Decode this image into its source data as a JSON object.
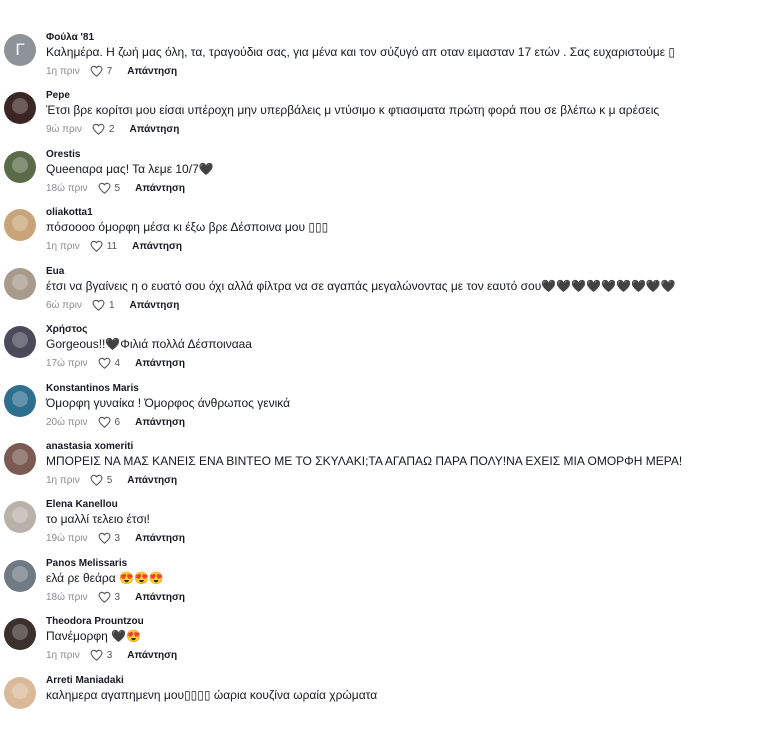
{
  "comments": [
    {
      "username": "Φούλα '81",
      "text": "Καλημέρα. Η ζωή μας όλη, τα, τραγούδια σας, για μένα και τον σύζυγό απ οταν ειμασταν 17 ετών . Σας ευχαριστούμε ▯",
      "time": "1η πριν",
      "likes": "7",
      "reply": "Απάντηση",
      "avatar_letter": "Γ",
      "avatar_color": "#8e939a"
    },
    {
      "username": "Pepe",
      "text": "Έτσι βρε κορίτσι μου είσαι υπέροχη μην υπερβάλεις μ ντύσιμο κ φτιασιματα πρώτη φορά που σε βλέπω κ μ αρέσεις",
      "time": "9ώ πριν",
      "likes": "2",
      "reply": "Απάντηση",
      "avatar_color": "#3a2623"
    },
    {
      "username": "Orestis",
      "text": "Queenαρα μας! Τα λεμε 10/7🖤",
      "time": "18ώ πριν",
      "likes": "5",
      "reply": "Απάντηση",
      "avatar_color": "#5b6b4a"
    },
    {
      "username": "oliakotta1",
      "text": "πόσοοοο όμορφη μέσα κι έξω βρε Δέσποινα μου ▯▯▯",
      "time": "1η πριν",
      "likes": "11",
      "reply": "Απάντηση",
      "avatar_color": "#c9a47a"
    },
    {
      "username": "Eua",
      "text": "έτσι να βγαίνεις η ο ευατό σου όχι αλλά φίλτρα να σε αγαπάς μεγαλώνοντας με τον εαυτό σου🖤🖤🖤🖤🖤🖤🖤🖤🖤",
      "time": "6ώ πριν",
      "likes": "1",
      "reply": "Απάντηση",
      "avatar_color": "#a89a8c"
    },
    {
      "username": "Χρήστος",
      "text": "Gorgeous!!🖤Φιλιά πολλά Δέσποιναaa",
      "time": "17ώ πριν",
      "likes": "4",
      "reply": "Απάντηση",
      "avatar_color": "#4a4a5a"
    },
    {
      "username": "Konstantinos Maris",
      "text": "Όμορφη γυναίκα ! Όμορφος άνθρωπος γενικά",
      "time": "20ώ πριν",
      "likes": "6",
      "reply": "Απάντηση",
      "avatar_color": "#2e6f8e"
    },
    {
      "username": "anastasia xomeriti",
      "text": "ΜΠΟΡΕΙΣ ΝΑ ΜΑΣ ΚΑΝΕΙΣ ΕΝΑ ΒΙΝΤΕΟ ΜΕ ΤΟ ΣΚΥΛΑΚΙ;ΤΑ ΑΓΑΠΑΩ ΠΑΡΑ ΠΟΛΥ!ΝΑ ΕΧΕΙΣ ΜΙΑ ΟΜΟΡΦΗ ΜΕΡΑ!",
      "time": "1η πριν",
      "likes": "5",
      "reply": "Απάντηση",
      "avatar_color": "#7a5a52"
    },
    {
      "username": "Elena Kanellou",
      "text": "το μαλλί τελειο έτσι!",
      "time": "19ώ πριν",
      "likes": "3",
      "reply": "Απάντηση",
      "avatar_color": "#b8b2a8"
    },
    {
      "username": "Panos Melissaris",
      "text": "ελά ρε θεάρα 😍😍😍",
      "time": "18ώ πριν",
      "likes": "3",
      "reply": "Απάντηση",
      "avatar_color": "#707a84"
    },
    {
      "username": "Theodora Prountzou",
      "text": "Πανέμορφη 🖤😍",
      "time": "1η πριν",
      "likes": "3",
      "reply": "Απάντηση",
      "avatar_color": "#3b302c"
    },
    {
      "username": "Arreti Maniadaki",
      "text": "καλημερα αγαπημενη μου▯▯▯▯ ώαρια κουζίνα ωραία χρώματα",
      "time": "",
      "likes": "",
      "reply": "",
      "avatar_color": "#d9b99a"
    }
  ]
}
